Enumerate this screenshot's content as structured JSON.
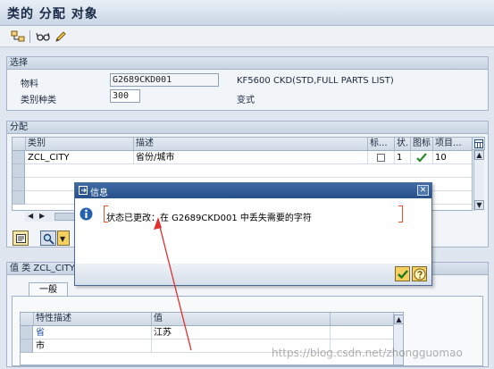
{
  "window": {
    "title": "类的 分配 对象"
  },
  "toolbar": {
    "icons": [
      "hierarchy-icon",
      "glasses-icon",
      "pencil-icon"
    ]
  },
  "selection": {
    "header": "选择",
    "material_label": "物料",
    "material_value": "G2689CKD001",
    "material_desc": "KF5600 CKD(STD,FULL PARTS LIST)",
    "class_type_label": "类别种类",
    "class_type_value": "300",
    "class_type_desc": "变式"
  },
  "assignment": {
    "header": "分配",
    "columns": [
      "类别",
      "描述",
      "标...",
      "状.",
      "图标",
      "项目..."
    ],
    "rows": [
      {
        "class": "ZCL_CITY",
        "desc": "省份/城市",
        "std": "",
        "status": "1",
        "icon": "check",
        "item": "10"
      }
    ]
  },
  "values": {
    "header": "值 类 ZCL_CITY",
    "tab": "一般",
    "columns": [
      "特性描述",
      "值"
    ],
    "rows": [
      {
        "char": "省",
        "value": "江苏"
      },
      {
        "char": "市",
        "value": ""
      }
    ]
  },
  "dialog": {
    "title": "信息",
    "message": "状态已更改：在 G2689CKD001 中丢失需要的字符"
  },
  "watermark": "https://blog.csdn.net/zhongguomao",
  "colors": {
    "accent": "#27508a",
    "panel": "#f1f4f8",
    "check": "#2a8a2a"
  }
}
